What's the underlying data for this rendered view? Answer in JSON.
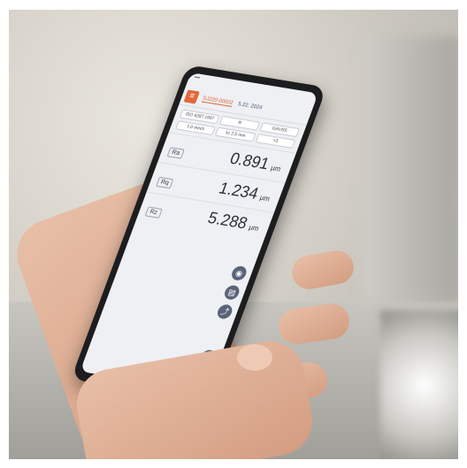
{
  "screen": {
    "tabs": [
      "SJ220-00002",
      "5.22. 2024"
    ],
    "params": [
      "ISO 4287:1997",
      "R",
      "GAUSS",
      "1.0 mm/s",
      "λc 2.5 mm",
      "×3"
    ],
    "readings": [
      {
        "label": "Ra",
        "value": "0.891",
        "unit": "μm"
      },
      {
        "label": "Rq",
        "value": "1.234",
        "unit": "μm"
      },
      {
        "label": "Rz",
        "value": "5.288",
        "unit": "μm"
      }
    ]
  }
}
